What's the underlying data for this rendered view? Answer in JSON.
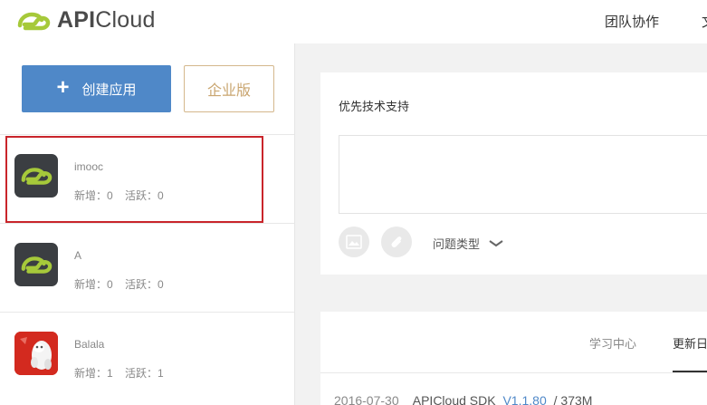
{
  "header": {
    "brand_api": "API",
    "brand_cloud": "Cloud",
    "nav_team": "团队协作",
    "nav_extra": "文"
  },
  "sidebar": {
    "create_button": "创建应用",
    "enterprise_button": "企业版",
    "apps": [
      {
        "name": "imooc",
        "new_label": "新增：0",
        "active_label": "活跃：0",
        "icon": "apicloud-logo-icon"
      },
      {
        "name": "A",
        "new_label": "新增：0",
        "active_label": "活跃：0",
        "icon": "apicloud-logo-icon"
      },
      {
        "name": "Balala",
        "new_label": "新增：1",
        "active_label": "活跃：1",
        "icon": "balala-app-icon"
      }
    ]
  },
  "support": {
    "title": "优先技术支持",
    "issue_type": "问题类型"
  },
  "updates": {
    "tab_learn": "学习中心",
    "tab_log": "更新日志",
    "row": {
      "date": "2016-07-30",
      "product": "APICloud SDK",
      "version": "V1.1.80",
      "size": "/ 373M"
    }
  },
  "colors": {
    "accent": "#4f88c8",
    "brand_green": "#a6c93a",
    "enterprise_gold": "#c9a56f",
    "selection": "#c9252b"
  }
}
